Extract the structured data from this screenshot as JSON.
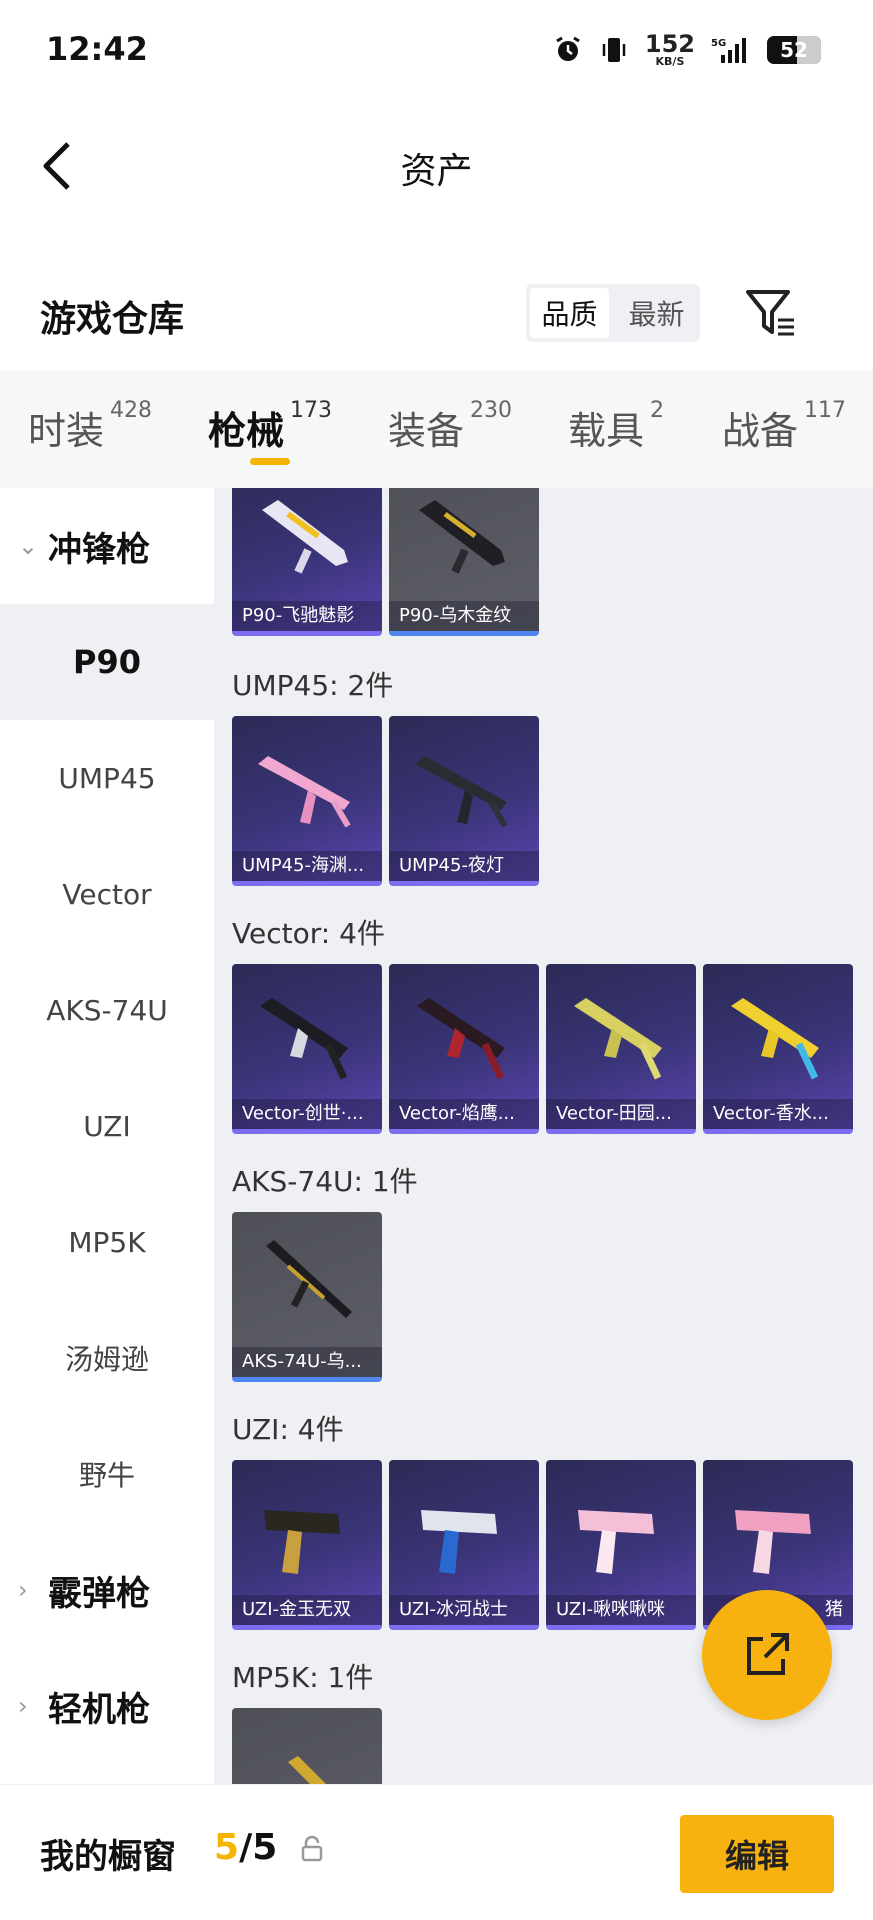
{
  "status_bar": {
    "time": "12:42",
    "net_speed": "152",
    "net_unit": "KB/S",
    "battery": "52"
  },
  "header": {
    "title": "资产"
  },
  "warehouse": {
    "title": "游戏仓库",
    "sort_options": [
      "品质",
      "最新"
    ],
    "sort_selected": "品质"
  },
  "tabs": [
    {
      "label": "时装",
      "count": "428"
    },
    {
      "label": "枪械",
      "count": "173",
      "active": true
    },
    {
      "label": "装备",
      "count": "230"
    },
    {
      "label": "载具",
      "count": "2"
    },
    {
      "label": "战备",
      "count": "117"
    }
  ],
  "sidebar": {
    "groups": [
      "冲锋枪",
      "霰弹枪",
      "轻机枪"
    ],
    "items": [
      "P90",
      "UMP45",
      "Vector",
      "AKS-74U",
      "UZI",
      "MP5K",
      "汤姆逊",
      "野牛"
    ],
    "selected": "P90"
  },
  "content": {
    "p90_cards": [
      "P90-飞驰魅影",
      "P90-乌木金纹"
    ],
    "ump45_title": "UMP45: 2件",
    "ump45_cards": [
      "UMP45-海渊...",
      "UMP45-夜灯"
    ],
    "vector_title": "Vector: 4件",
    "vector_cards": [
      "Vector-创世·...",
      "Vector-焰鹰...",
      "Vector-田园...",
      "Vector-香水..."
    ],
    "aks_title": "AKS-74U: 1件",
    "aks_cards": [
      "AKS-74U-乌..."
    ],
    "uzi_title": "UZI: 4件",
    "uzi_cards": [
      "UZI-金玉无双",
      "UZI-冰河战士",
      "UZI-啾咪啾咪",
      "猪"
    ],
    "mp5k_title": "MP5K: 1件"
  },
  "bottom_bar": {
    "label": "我的橱窗",
    "current": "5",
    "total": "/5",
    "edit": "编辑"
  },
  "colors": {
    "accent": "#f5b400",
    "card_purple": "#3a3478",
    "card_gray": "#5e5f68"
  }
}
